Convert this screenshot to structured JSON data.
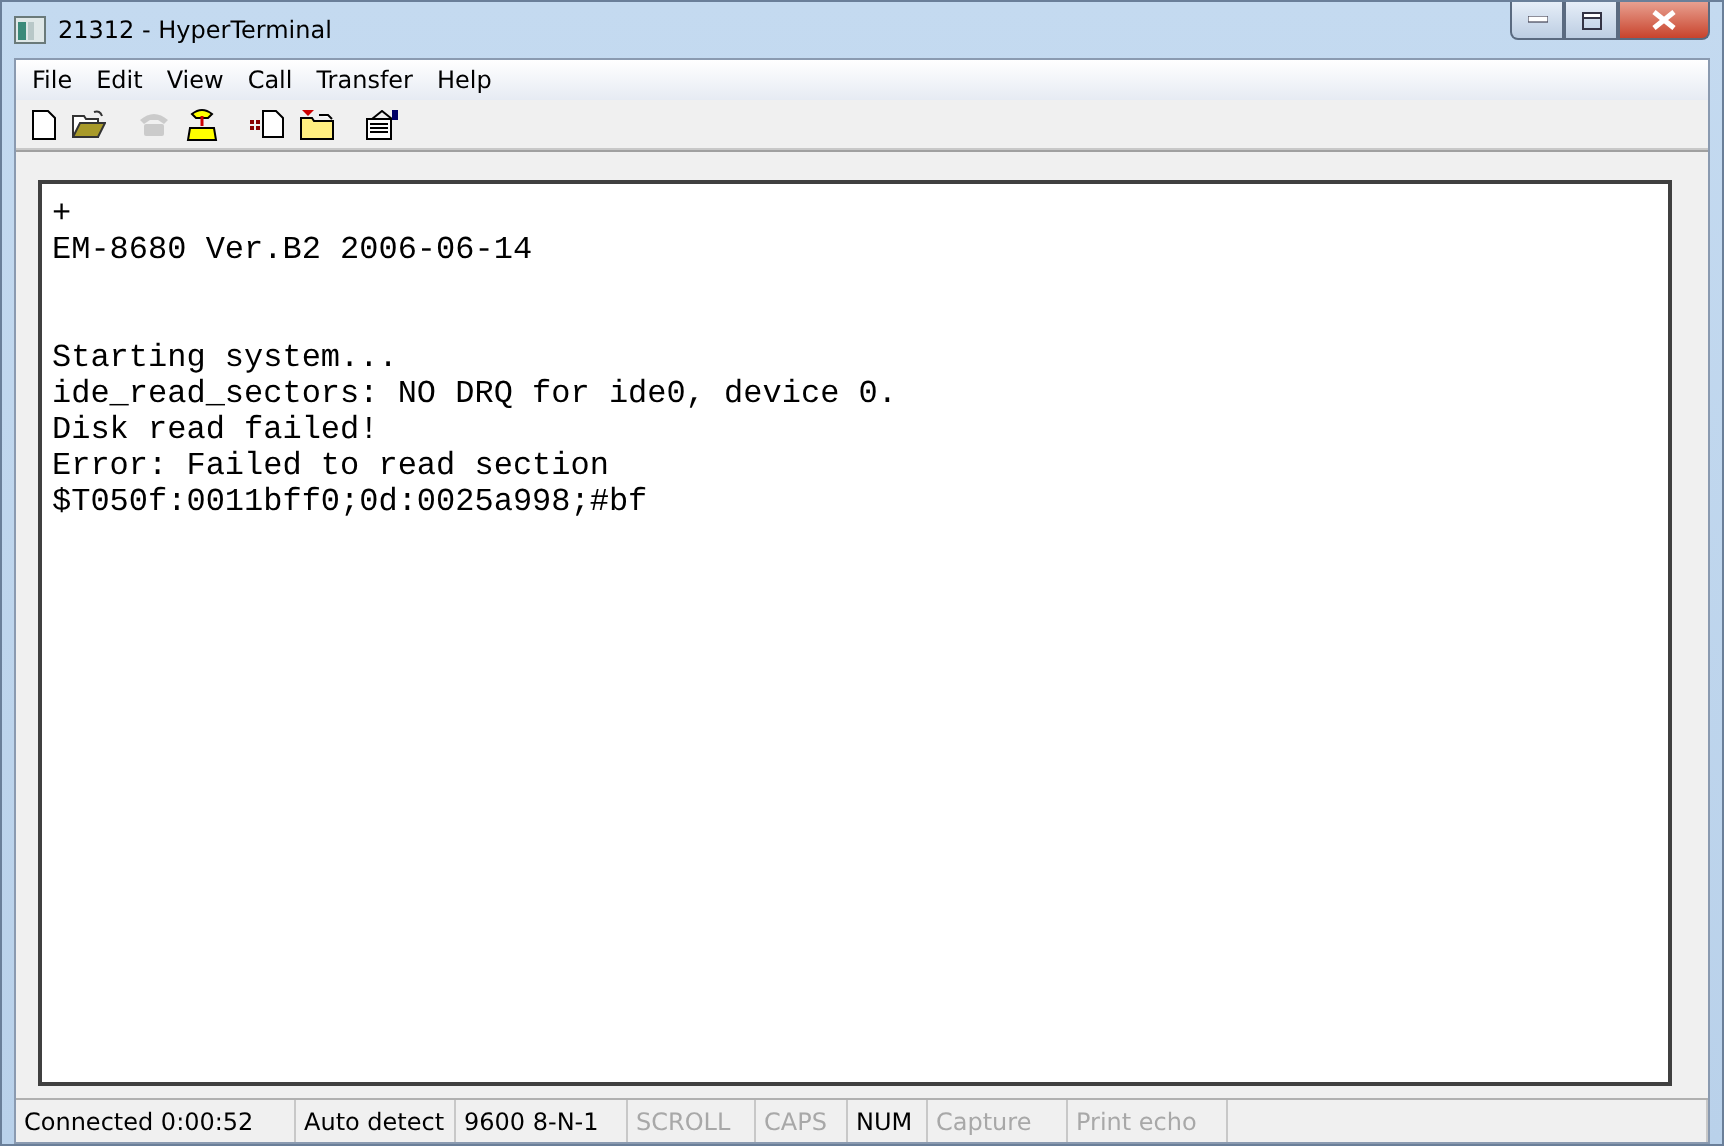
{
  "window": {
    "title": "21312 - HyperTerminal"
  },
  "menu": [
    "File",
    "Edit",
    "View",
    "Call",
    "Transfer",
    "Help"
  ],
  "toolbar": [
    {
      "disabled": false
    },
    {
      "disabled": false
    },
    {
      "disabled": true
    },
    {
      "disabled": false
    },
    {
      "disabled": false
    },
    {
      "disabled": false
    },
    {
      "disabled": false
    }
  ],
  "terminal": {
    "blocks": [
      {
        "lines": [
          "+",
          "EM-8680 Ver.B2 2006-06-14"
        ]
      },
      {
        "lines": [
          "Starting system...",
          "ide_read_sectors: NO DRQ for ide0, device 0.",
          "Disk read failed!",
          "Error: Failed to read section",
          "$T050f:0011bff0;0d:0025a998;#bf"
        ]
      }
    ]
  },
  "status_bar": [
    {
      "text": "Connected 0:00:52",
      "disabled": false
    },
    {
      "text": "Auto detect",
      "disabled": false
    },
    {
      "text": "9600 8-N-1",
      "disabled": false
    },
    {
      "text": "SCROLL",
      "disabled": true
    },
    {
      "text": "CAPS",
      "disabled": true
    },
    {
      "text": "NUM",
      "disabled": false
    },
    {
      "text": "Capture",
      "disabled": true
    },
    {
      "text": "Print echo",
      "disabled": true
    }
  ]
}
